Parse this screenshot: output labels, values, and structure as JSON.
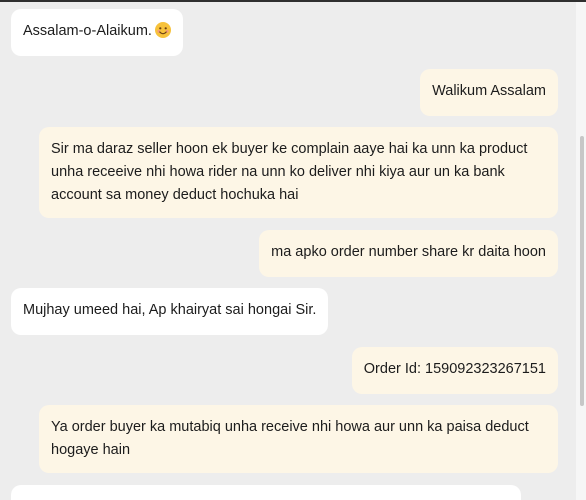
{
  "messages": [
    {
      "side": "incoming",
      "text": "Assalam-o-Alaikum.",
      "emoji": "smiling-face-icon"
    },
    {
      "side": "outgoing",
      "text": "Walikum Assalam"
    },
    {
      "side": "outgoing",
      "text": "Sir ma daraz seller hoon ek buyer ke complain aaye hai ka unn ka product unha receeive nhi howa rider na unn ko deliver nhi kiya aur un ka bank account sa money deduct hochuka hai"
    },
    {
      "side": "outgoing",
      "text": "ma apko order number share kr daita hoon"
    },
    {
      "side": "incoming",
      "text": "Mujhay umeed hai, Ap khairyat sai hongai Sir."
    },
    {
      "side": "outgoing",
      "text": "Order Id: 159092323267151"
    },
    {
      "side": "outgoing",
      "text": "Ya order buyer ka mutabiq unha receive nhi howa aur unn ka paisa deduct hogaye hain"
    }
  ],
  "colors": {
    "background": "#ededed",
    "incoming_bubble": "#ffffff",
    "outgoing_bubble": "#fdf6e6"
  }
}
